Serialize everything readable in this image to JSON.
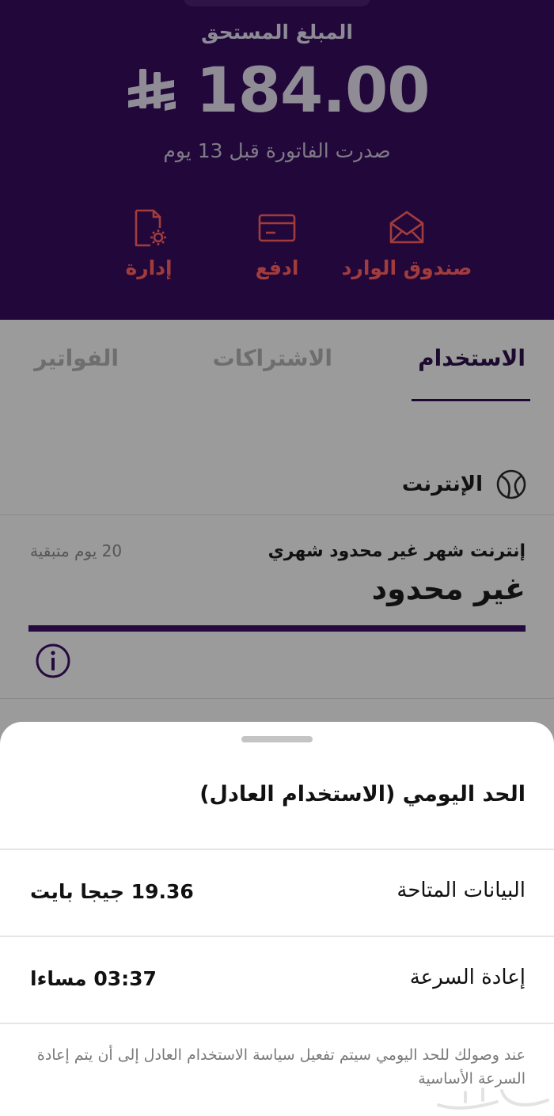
{
  "header": {
    "amount_label": "المبلغ المستحق",
    "amount_value": "184.00",
    "currency_icon": "saudi-riyal-icon",
    "bill_issued": "صدرت الفاتورة قبل 13 يوم",
    "actions": [
      {
        "label": "صندوق الوارد",
        "icon": "envelope-icon"
      },
      {
        "label": "ادفع",
        "icon": "credit-card-icon"
      },
      {
        "label": "إدارة",
        "icon": "document-settings-icon"
      }
    ]
  },
  "tabs": [
    {
      "label": "الاستخدام",
      "active": true
    },
    {
      "label": "الاشتراكات",
      "active": false
    },
    {
      "label": "الفواتير",
      "active": false
    }
  ],
  "usage": {
    "section_title": "الإنترنت",
    "section_icon": "globe-icon",
    "plan_name": "إنترنت شهر غير محدود شهري",
    "days_left": "20 يوم متبقية",
    "plan_value": "غير محدود",
    "info_icon": "info-icon"
  },
  "sheet": {
    "title": "الحد اليومي (الاستخدام العادل)",
    "rows": [
      {
        "label": "البيانات المتاحة",
        "value": "19.36 جيجا بايت"
      },
      {
        "label": "إعادة السرعة",
        "value": "03:37 مساءا"
      }
    ],
    "note": "عند وصولك للحد اليومي سيتم تفعيل سياسة الاستخدام العادل إلى أن يتم إعادة السرعة الأساسية"
  },
  "colors": {
    "header_bg": "#22083a",
    "accent_red": "#a23c3c",
    "dim_overlay": "#9b9b9b",
    "progress": "#25093f"
  }
}
